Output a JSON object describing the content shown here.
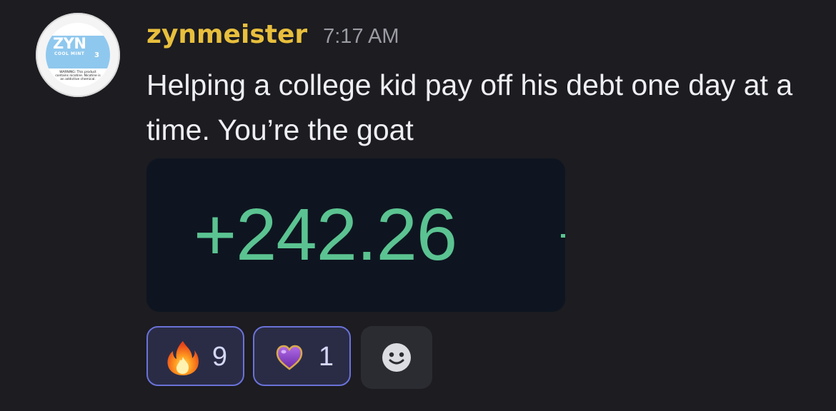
{
  "message": {
    "author": "zynmeister",
    "timestamp": "7:17 AM",
    "text": "Helping a college kid pay off his debt one day at a time. You’re the goat",
    "author_color": "#e8bf3d",
    "avatar": {
      "icon": "zyn-can-icon",
      "brand_text": "ZYN",
      "flavor_text": "COOL MINT",
      "strength_text": "3",
      "warning_text": "WARNING: This product contains nicotine. Nicotine is an addictive chemical."
    },
    "attachment": {
      "amount_text": "+242.26",
      "amount_color": "#5bc391"
    },
    "reactions": [
      {
        "emoji": "fire-icon",
        "count": "9"
      },
      {
        "emoji": "purple-heart-icon",
        "count": "1"
      }
    ],
    "add_reaction_icon": "smiley-add-reaction-icon"
  }
}
